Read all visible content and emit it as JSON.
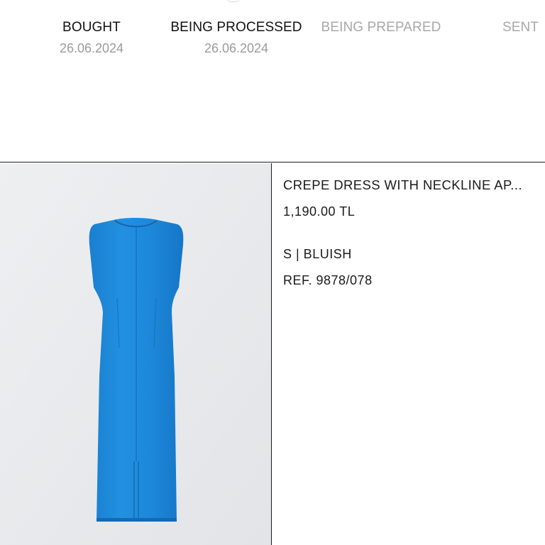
{
  "tracker": {
    "steps": [
      {
        "label": "BOUGHT",
        "date": "26.06.2024",
        "state": "done"
      },
      {
        "label": "BEING PROCESSED",
        "date": "26.06.2024",
        "state": "done"
      },
      {
        "label": "BEING PREPARED",
        "date": "",
        "state": "pending"
      },
      {
        "label": "SENT",
        "date": "",
        "state": "pending"
      }
    ]
  },
  "item": {
    "name": "CREPE DRESS WITH NECKLINE AP...",
    "price": "1,190.00 TL",
    "variant": "S | BLUISH",
    "reference": "REF. 9878/078",
    "image_icon": "dress-product-photo"
  },
  "colors": {
    "dress": "#1e88d8",
    "image_background": "#e9eaec",
    "pending_text": "#a8a8a8",
    "date_text": "#9a9a9a",
    "divider": "#1c1c1c"
  }
}
